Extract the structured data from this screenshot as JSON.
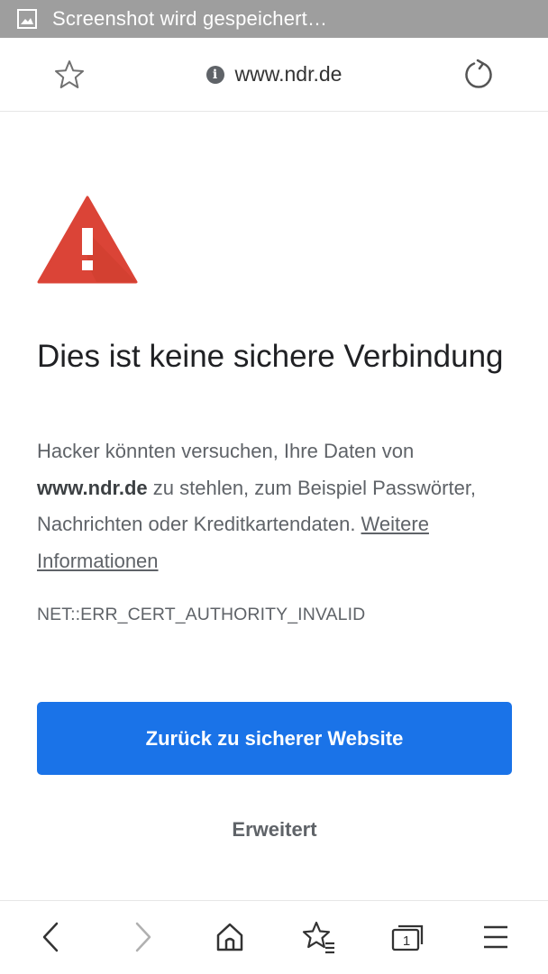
{
  "status_bar": {
    "notification_icon": "image-icon",
    "text": "Screenshot wird gespeichert…"
  },
  "url_bar": {
    "bookmark_icon": "star-icon",
    "info_icon_glyph": "i",
    "url": "www.ndr.de",
    "reload_icon": "reload-icon"
  },
  "interstitial": {
    "warning_icon": "warning-triangle-icon",
    "heading": "Dies ist keine sichere Verbindung",
    "paragraph": {
      "text_before": "Hacker könnten versuchen, Ihre Daten von ",
      "domain": "www.ndr.de",
      "text_after": " zu stehlen, zum Beispiel Passwörter, Nachrichten oder Kreditkartendaten. ",
      "link": "Weitere Informationen"
    },
    "error_code": "NET::ERR_CERT_AUTHORITY_INVALID",
    "primary_button": "Zurück zu sicherer Website",
    "advanced_button": "Erweitert"
  },
  "bottom_nav": {
    "tab_count": "1",
    "items": [
      "back-icon",
      "forward-icon",
      "home-icon",
      "bookmarks-icon",
      "tabs-icon",
      "menu-icon"
    ]
  },
  "colors": {
    "status_bar": "#9e9e9e",
    "primary_button": "#1a73e8",
    "warning_red": "#db4437",
    "text_primary": "#202124",
    "text_secondary": "#5f6368"
  }
}
